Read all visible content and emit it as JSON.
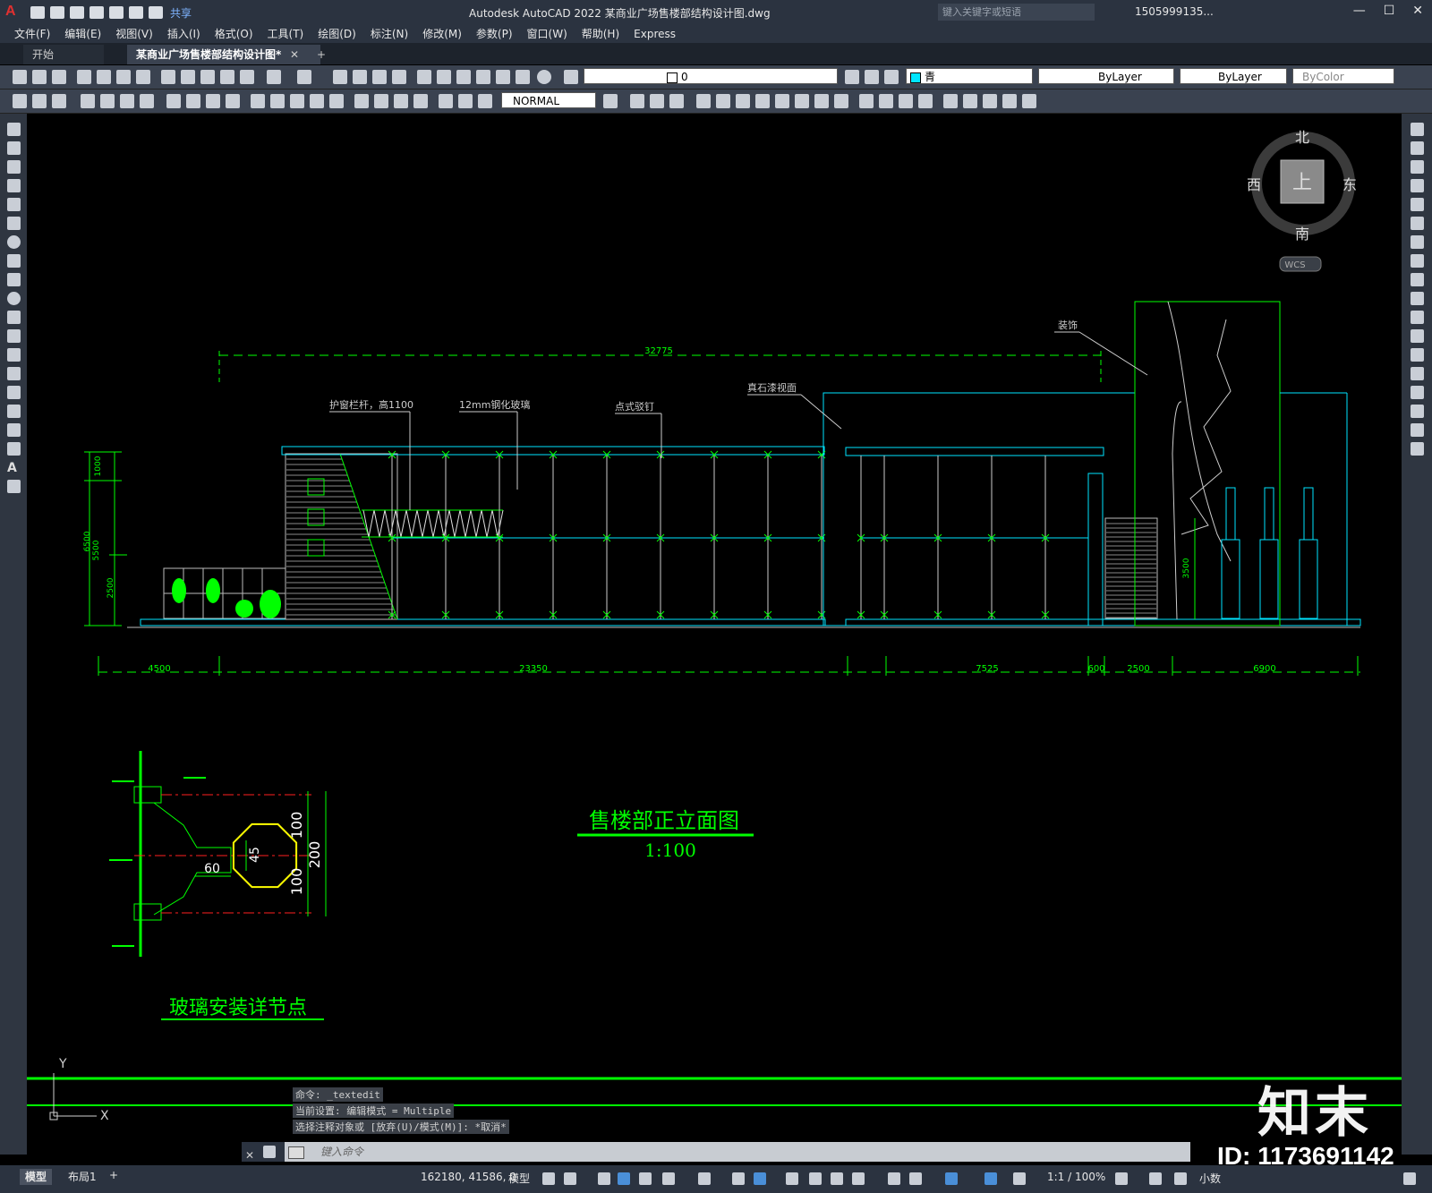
{
  "titlebar": {
    "app_logo": "A",
    "share": "共享",
    "title": "Autodesk AutoCAD 2022    某商业广场售楼部结构设计图.dwg",
    "search_placeholder": "键入关键字或短语",
    "user": "1505999135...",
    "minimize": "—",
    "maximize": "☐",
    "close": "✕"
  },
  "menubar": {
    "items": [
      "文件(F)",
      "编辑(E)",
      "视图(V)",
      "插入(I)",
      "格式(O)",
      "工具(T)",
      "绘图(D)",
      "标注(N)",
      "修改(M)",
      "参数(P)",
      "窗口(W)",
      "帮助(H)",
      "Express"
    ]
  },
  "tabs": {
    "start": "开始",
    "document": "某商业广场售楼部结构设计图*",
    "close": "✕",
    "add": "+"
  },
  "toolbar": {
    "layer": "0",
    "color": "青",
    "linetype": "ByLayer",
    "lineweight": "ByLayer",
    "plotstyle": "ByColor",
    "dimstyle": "NORMAL"
  },
  "colors": {
    "green": "#00ff00",
    "cyan": "#00e5ff",
    "yellow": "#ffff00",
    "red": "#ff2020",
    "white": "#e0e0e0"
  },
  "viewcube": {
    "north": "北",
    "south": "南",
    "east": "东",
    "west": "西",
    "top": "上",
    "wcs": "WCS"
  },
  "drawing": {
    "dim_total": "32775",
    "dim_h1": "1000",
    "dim_h2": "6500",
    "dim_h3": "5500",
    "dim_h4": "2500",
    "dim_right_h": "3500",
    "dim_bottom": [
      "4500",
      "23350",
      "7525",
      "600",
      "2500",
      "6900"
    ],
    "labels": {
      "railing": "护窗栏杆，高1100",
      "glass": "12mm钢化玻璃",
      "bolt": "点式驳钉",
      "stone": "真石漆视面",
      "sculpture": "装饰"
    },
    "elevation_title": "售楼部正立面图",
    "elevation_scale": "1:100",
    "detail_title": "玻璃安装详节点",
    "detail_dims": [
      "100",
      "200",
      "100",
      "45",
      "60"
    ]
  },
  "ucs": {
    "y": "Y",
    "x": "X"
  },
  "command": {
    "history": [
      "命令: _textedit",
      "当前设置: 编辑模式 = Multiple",
      "选择注释对象或 [放弃(U)/模式(M)]: *取消*"
    ],
    "placeholder": "键入命令"
  },
  "statusbar": {
    "model_tab": "模型",
    "layout_tab": "布局1",
    "add": "+",
    "coords": "162180, 41586, 0",
    "space": "模型",
    "scale": "1:1 / 100%",
    "units": "小数"
  },
  "watermark": {
    "logo": "知末",
    "id": "ID: 1173691142"
  }
}
